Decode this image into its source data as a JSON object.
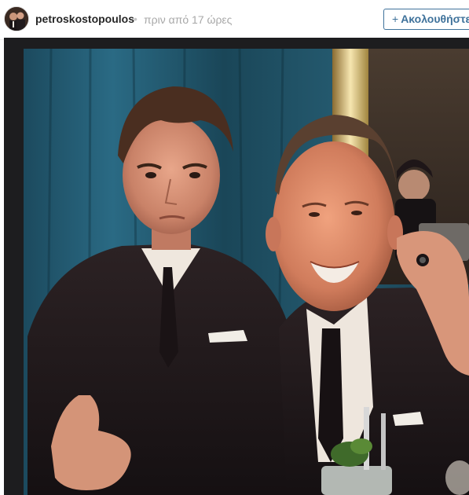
{
  "post_header": {
    "username": "petroskostopoulos",
    "separator": "•",
    "timestamp": "πριν από 17 ώρες",
    "follow_plus": "+",
    "follow_label": "Ακολουθήστε"
  },
  "colors": {
    "follow_accent": "#3f729b",
    "username_text": "#262626",
    "timestamp_text": "#a8a8a8",
    "frame_dark": "#1d1d1f"
  },
  "icons": {
    "avatar": "profile-photo-thumbnail",
    "follow": "plus-icon"
  }
}
